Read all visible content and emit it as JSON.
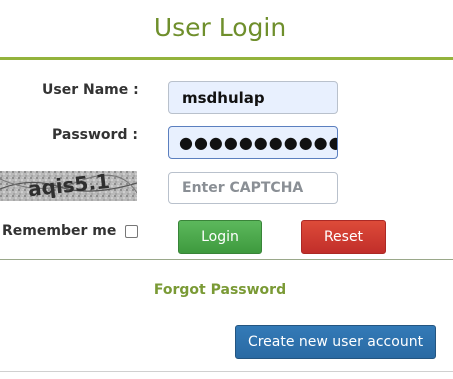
{
  "login": {
    "title": "User Login",
    "username_label": "User Name :",
    "username_value": "msdhulap",
    "password_label": "Password :",
    "password_value": "●●●●●●●●●●●●●●●",
    "captcha_text": "aqis5.1",
    "captcha_placeholder": "Enter CAPTCHA",
    "remember_label": "Remember me",
    "login_button": "Login",
    "reset_button": "Reset",
    "forgot_link": "Forgot Password",
    "create_button": "Create new user account"
  },
  "colors": {
    "title_green": "#6f8f2c",
    "rule_green": "#93b33c",
    "login_green": "#5cb85c",
    "reset_red": "#d9534f",
    "create_blue": "#337ab7"
  },
  "icons": {
    "captcha": "captcha-image",
    "checkbox": "checkbox-unchecked"
  }
}
